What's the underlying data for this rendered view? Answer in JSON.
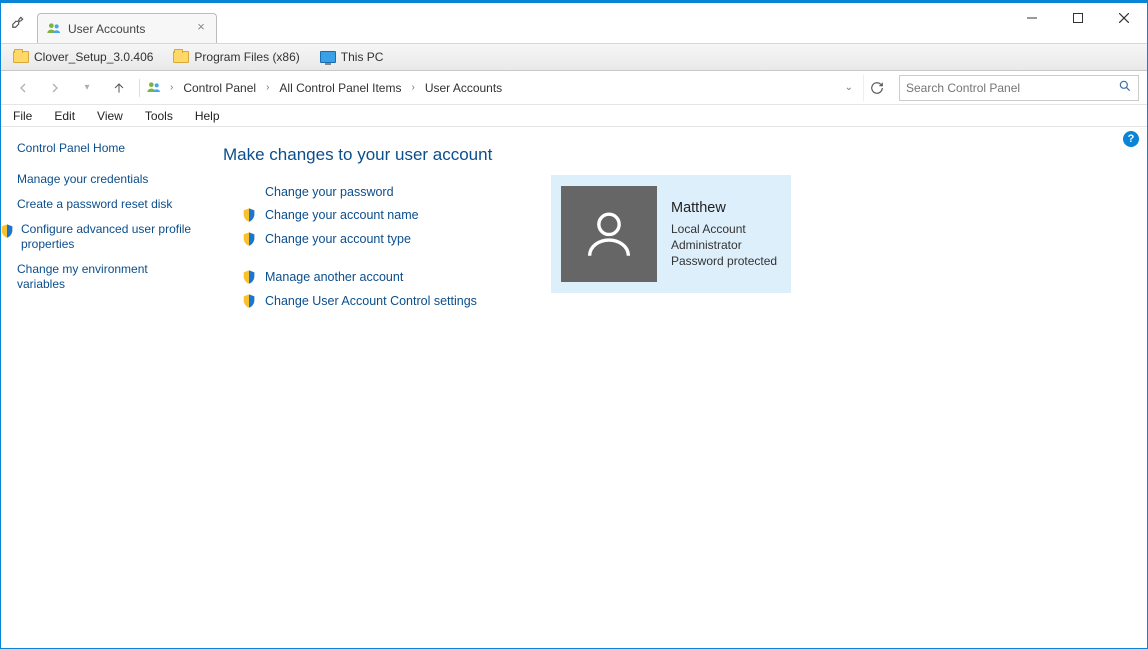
{
  "tab": {
    "title": "User Accounts"
  },
  "bookmarks": {
    "item1": "Clover_Setup_3.0.406",
    "item2": "Program Files (x86)",
    "item3": "This PC"
  },
  "breadcrumb": {
    "c1": "Control Panel",
    "c2": "All Control Panel Items",
    "c3": "User Accounts"
  },
  "search": {
    "placeholder": "Search Control Panel"
  },
  "menu": {
    "file": "File",
    "edit": "Edit",
    "view": "View",
    "tools": "Tools",
    "help": "Help"
  },
  "sidebar": {
    "home": "Control Panel Home",
    "l1": "Manage your credentials",
    "l2": "Create a password reset disk",
    "l3": "Configure advanced user profile properties",
    "l4": "Change my environment variables"
  },
  "main": {
    "heading": "Make changes to your user account",
    "a1": "Change your password",
    "a2": "Change your account name",
    "a3": "Change your account type",
    "a4": "Manage another account",
    "a5": "Change User Account Control settings"
  },
  "user": {
    "name": "Matthew",
    "line1": "Local Account",
    "line2": "Administrator",
    "line3": "Password protected"
  }
}
